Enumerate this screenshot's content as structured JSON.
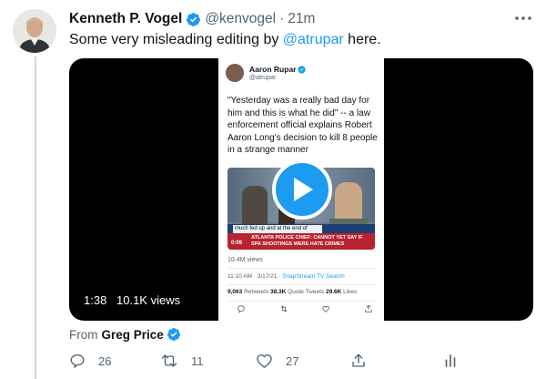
{
  "tweet": {
    "author_name": "Kenneth P. Vogel",
    "handle": "@kenvogel",
    "separator": "·",
    "time": "21m",
    "text_before": "Some very misleading editing by ",
    "mention": "@atrupar",
    "text_after": " here."
  },
  "embedded_tweet": {
    "author_name": "Aaron Rupar",
    "handle": "@atrupar",
    "text": "\"Yesterday was a really bad day for him and this is what he did\" -- a law enforcement official explains Robert Aaron Long's decision to kill 8 people in a strange manner",
    "video": {
      "caption": "much fed up and at the end of",
      "timer": "0:09",
      "ticker": "ATLANTA POLICE CHIEF: CANNOT YET SAY IF SPA SHOOTINGS WERE HATE CRIMES"
    },
    "views": "10.4M views",
    "timestamp": "11:10 AM · 3/17/21 · ",
    "source": "SnapStream TV Search",
    "retweets_count": "9,063",
    "retweets_label": " Retweets  ",
    "quote_count": "38.3K",
    "quote_label": " Quote Tweets  ",
    "likes_count": "29.6K",
    "likes_label": " Likes"
  },
  "video": {
    "duration": "1:38",
    "views": "10.1K views"
  },
  "attribution": {
    "prefix": "From",
    "name": "Greg Price"
  },
  "actions": {
    "reply_count": "26",
    "retweet_count": "11",
    "like_count": "27"
  },
  "colors": {
    "accent": "#1d9bf0",
    "secondary_text": "#536471"
  }
}
